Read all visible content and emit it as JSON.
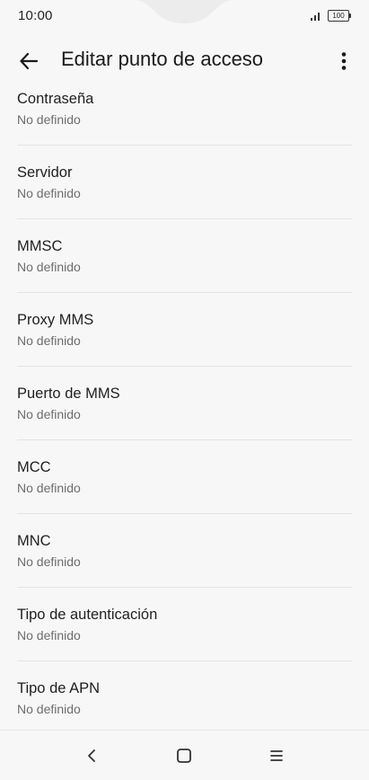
{
  "status_bar": {
    "time": "10:00",
    "battery": "100"
  },
  "app_bar": {
    "title": "Editar punto de acceso"
  },
  "settings": [
    {
      "label": "Contraseña",
      "value": "No definido"
    },
    {
      "label": "Servidor",
      "value": "No definido"
    },
    {
      "label": "MMSC",
      "value": "No definido"
    },
    {
      "label": "Proxy MMS",
      "value": "No definido"
    },
    {
      "label": "Puerto de MMS",
      "value": "No definido"
    },
    {
      "label": "MCC",
      "value": "No definido"
    },
    {
      "label": "MNC",
      "value": "No definido"
    },
    {
      "label": "Tipo de autenticación",
      "value": "No definido"
    },
    {
      "label": "Tipo de APN",
      "value": "No definido"
    }
  ],
  "icons": {
    "back": "arrow-back-icon",
    "more": "more-vert-icon",
    "nav_back": "chevron-left-icon",
    "nav_home": "square-home-icon",
    "nav_recents": "menu-lines-icon",
    "signal": "signal-icon",
    "battery": "battery-icon"
  },
  "colors": {
    "background": "#f7f7f7",
    "text_primary": "#1f1f1f",
    "text_secondary": "#6d6d6d",
    "divider": "#e3e3e3"
  }
}
